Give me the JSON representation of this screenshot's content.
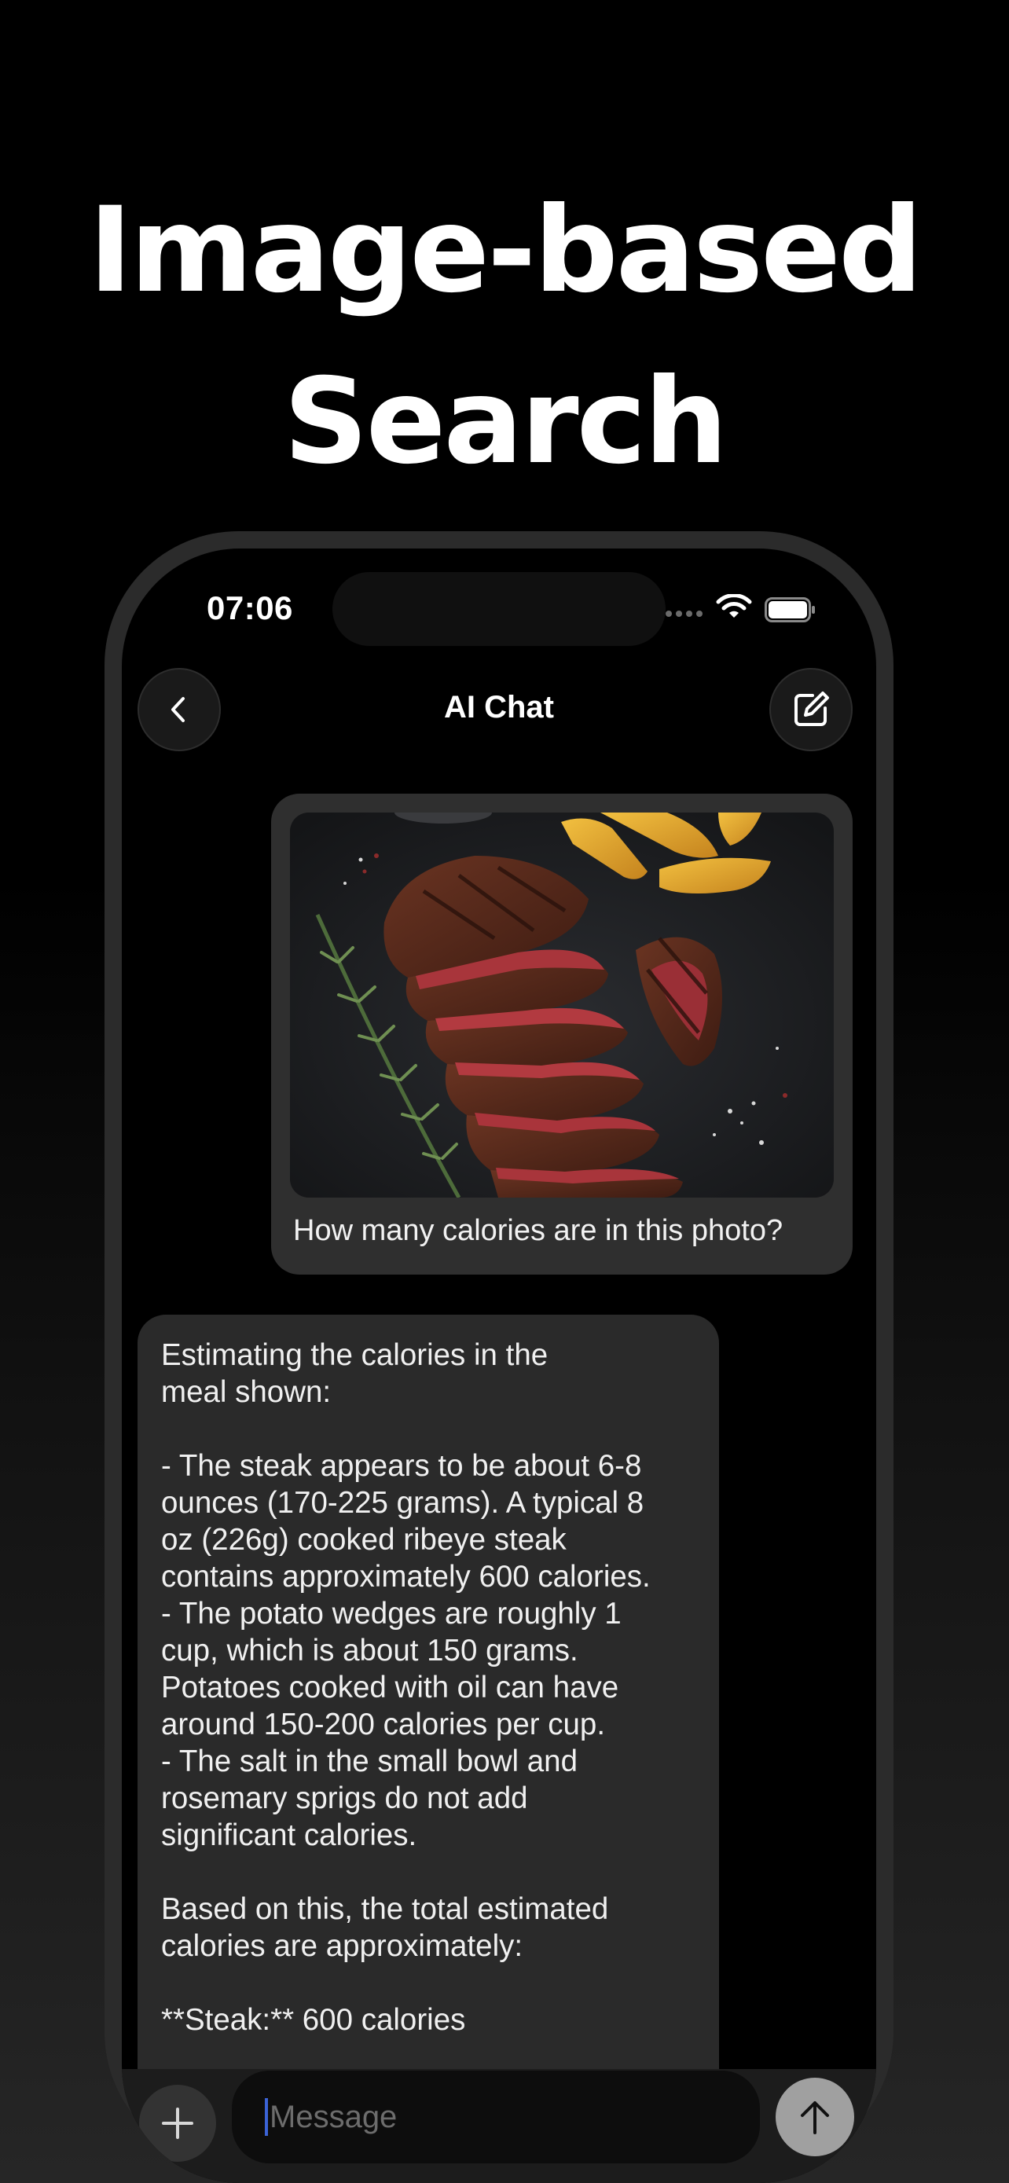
{
  "headline": {
    "line1": "Image-based",
    "line2": "Search"
  },
  "status_bar": {
    "time": "07:06",
    "icons": [
      "wifi-icon",
      "battery-icon"
    ]
  },
  "nav": {
    "title": "AI Chat",
    "back_icon": "chevron-left-icon",
    "compose_icon": "compose-icon"
  },
  "chat": {
    "user_message": {
      "image": "steak-photo",
      "text": "How many calories are in this photo?"
    },
    "assistant_message": {
      "text": "Estimating the calories in the\nmeal shown:\n\n- The steak appears to be about 6-8\nounces (170-225 grams). A typical 8\noz (226g) cooked ribeye steak\ncontains approximately 600 calories.\n- The potato wedges are roughly 1\ncup, which is about 150 grams.\nPotatoes cooked with oil can have\naround 150-200 calories per cup.\n- The salt in the small bowl and\nrosemary sprigs do not add\nsignificant calories.\n\nBased on this, the total estimated\ncalories are approximately:\n\n**Steak:** 600 calories"
    }
  },
  "composer": {
    "placeholder": "Message",
    "plus_icon": "plus-icon",
    "send_icon": "arrow-up-icon"
  },
  "colors": {
    "background": "#000000",
    "bubble_user": "#2f2f2f",
    "bubble_ai": "#2a2a2a",
    "send_button": "#a0a0a0",
    "caret": "#3b63d6"
  }
}
